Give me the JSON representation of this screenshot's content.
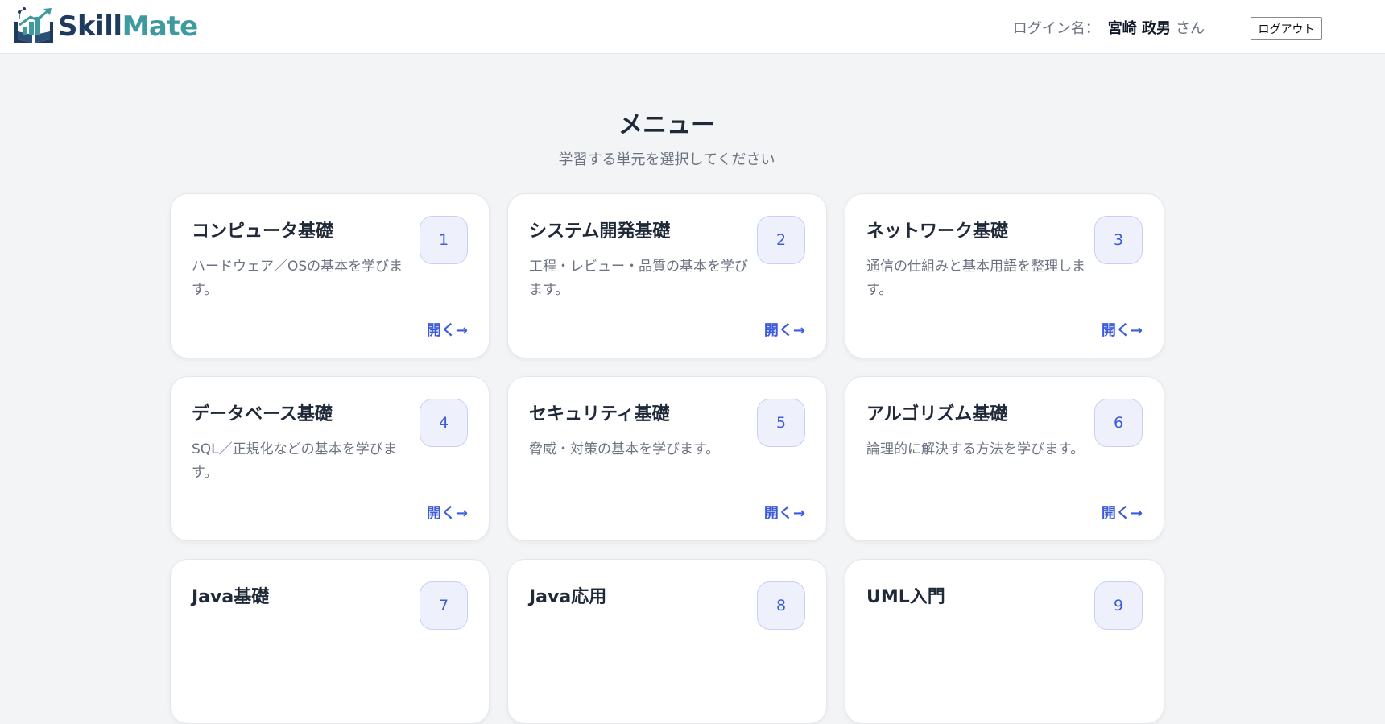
{
  "header": {
    "logo_skill": "Skill",
    "logo_mate": "Mate",
    "user_label": "ログイン名：",
    "user_name": "宮崎 政男",
    "user_suffix": "さん",
    "logout_label": "ログアウト"
  },
  "main": {
    "title": "メニュー",
    "subtitle": "学習する単元を選択してください"
  },
  "cards": [
    {
      "title": "コンピュータ基礎",
      "desc": "ハードウェア／OSの基本を学びます。",
      "num": "1",
      "open": "開く→"
    },
    {
      "title": "システム開発基礎",
      "desc": "工程・レビュー・品質の基本を学びます。",
      "num": "2",
      "open": "開く→"
    },
    {
      "title": "ネットワーク基礎",
      "desc": "通信の仕組みと基本用語を整理します。",
      "num": "3",
      "open": "開く→"
    },
    {
      "title": "データベース基礎",
      "desc": "SQL／正規化などの基本を学びます。",
      "num": "4",
      "open": "開く→"
    },
    {
      "title": "セキュリティ基礎",
      "desc": "脅威・対策の基本を学びます。",
      "num": "5",
      "open": "開く→"
    },
    {
      "title": "アルゴリズム基礎",
      "desc": "論理的に解決する方法を学びます。",
      "num": "6",
      "open": "開く→"
    },
    {
      "title": "Java基礎",
      "desc": "",
      "num": "7",
      "open": ""
    },
    {
      "title": "Java応用",
      "desc": "",
      "num": "8",
      "open": ""
    },
    {
      "title": "UML入門",
      "desc": "",
      "num": "9",
      "open": ""
    }
  ],
  "colors": {
    "accent": "#3b5bdb",
    "logo_dark": "#1e3a5f",
    "logo_teal": "#3f9aa0",
    "background": "#f3f4f6"
  }
}
